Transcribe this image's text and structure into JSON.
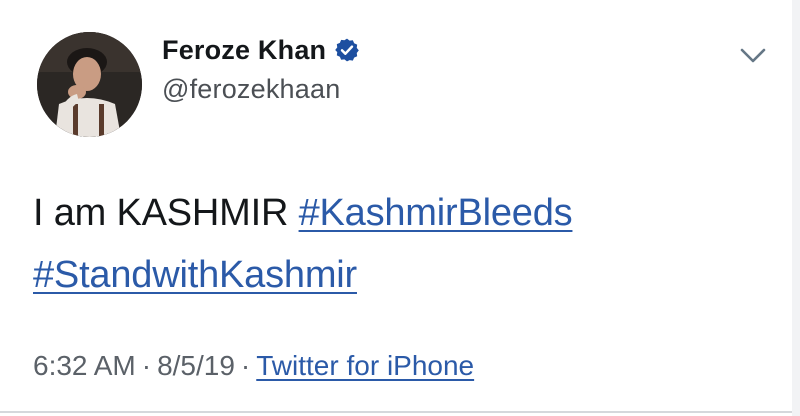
{
  "author": {
    "display_name": "Feroze Khan",
    "handle": "@ferozekhaan",
    "verified": true
  },
  "tweet": {
    "text_plain": "I am KASHMIR",
    "hashtags": [
      "#KashmirBleeds",
      "#StandwithKashmir"
    ]
  },
  "meta": {
    "time": "6:32 AM",
    "separator": "·",
    "date": "8/5/19",
    "source": "Twitter for iPhone"
  },
  "icons": {
    "verified": "verified-badge-icon",
    "more": "chevron-down-icon"
  },
  "colors": {
    "link": "#2b5aa8",
    "verified": "#1d4fa0",
    "text": "#14171a",
    "muted": "#5b6168"
  }
}
